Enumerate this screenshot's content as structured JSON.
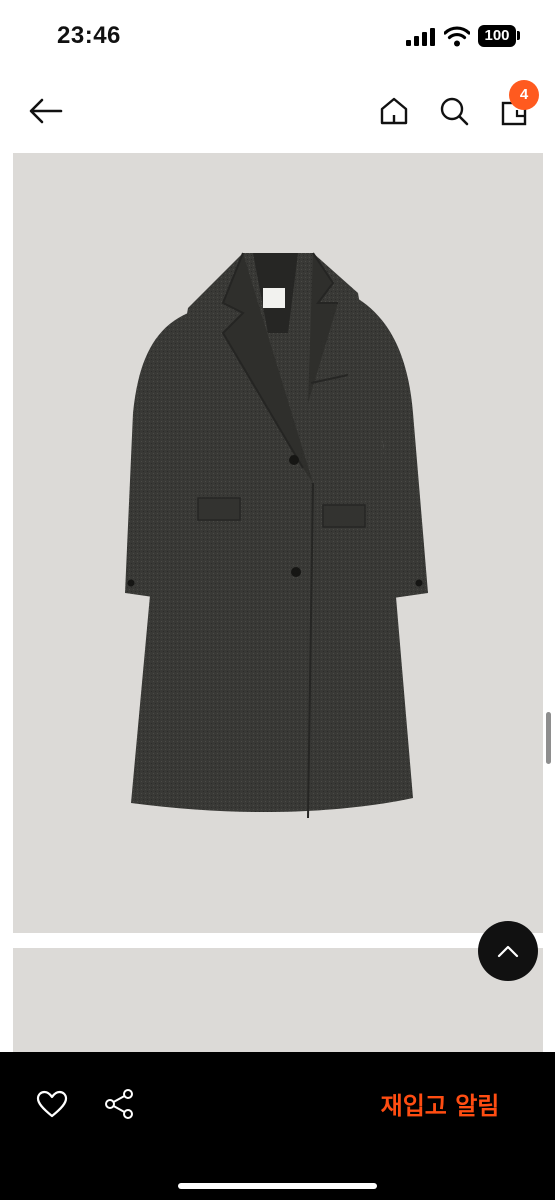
{
  "status_bar": {
    "time": "23:46",
    "battery": "100"
  },
  "nav": {
    "icons": [
      "arrow-left-icon",
      "home-icon",
      "search-icon",
      "shopping-bag-icon"
    ],
    "cart_count": "4"
  },
  "product": {
    "images": [
      "coat-photo",
      "second-photo"
    ],
    "colors": {
      "background": "#dcdad7",
      "coat": "#383835"
    }
  },
  "bottom_bar": {
    "icons": [
      "heart-icon",
      "share-icon"
    ],
    "restock_label": "재입고 알림"
  },
  "colors": {
    "accent": "#ff4d12",
    "badge": "#ff5a1f",
    "bar": "#000000"
  }
}
